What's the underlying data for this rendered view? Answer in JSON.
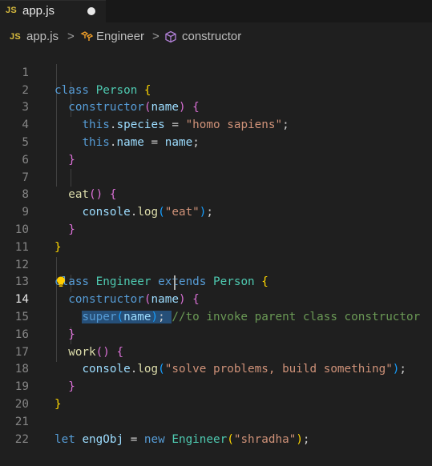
{
  "tab": {
    "badge": "JS",
    "filename": "app.js"
  },
  "breadcrumb": {
    "file_badge": "JS",
    "file": "app.js",
    "class": "Engineer",
    "method": "constructor",
    "sep": ">"
  },
  "lines": {
    "n1": "1",
    "n2": "2",
    "n3": "3",
    "n4": "4",
    "n5": "5",
    "n6": "6",
    "n7": "7",
    "n8": "8",
    "n9": "9",
    "n10": "10",
    "n11": "11",
    "n12": "12",
    "n13": "13",
    "n14": "14",
    "n15": "15",
    "n16": "16",
    "n17": "17",
    "n18": "18",
    "n19": "19",
    "n20": "20",
    "n21": "21",
    "n22": "22"
  },
  "code": {
    "l1": "class Person {",
    "l2": "constructor(name) {",
    "l3": "this.species = \"homo sapiens\";",
    "l4": "this.name = name;",
    "l5": "}",
    "l7": "eat() {",
    "l8": "console.log(\"eat\");",
    "l9": "}",
    "l10": "}",
    "l12": "class Engineer extends Person {",
    "l13": "constructor(name) {",
    "l14": "super(name); //to invoke parent class constructor",
    "l15": "}",
    "l16": "work() {",
    "l17": "console.log(\"solve problems, build something\");",
    "l18": "}",
    "l19": "}",
    "l21": "let engObj = new Engineer(\"shradha\");"
  },
  "colors": {
    "background": "#1f1f1f",
    "keyword": "#569cd6",
    "string": "#ce9178",
    "comment": "#6a9955",
    "function": "#dcdcaa",
    "class": "#4ec9b0",
    "selection": "#264f78"
  }
}
